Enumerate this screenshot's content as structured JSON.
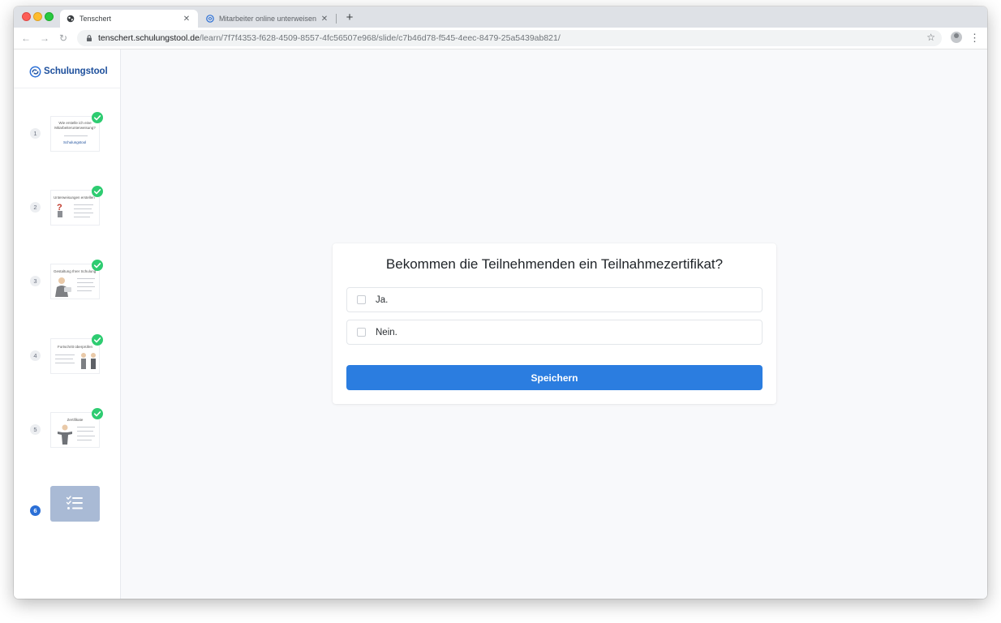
{
  "browser": {
    "tabs": [
      {
        "title": "Tenschert",
        "icon": "globe-icon",
        "close": "✕"
      },
      {
        "title": "Mitarbeiter online unterweisen",
        "icon": "schulungstool-icon",
        "close": "✕"
      }
    ],
    "new_tab": "+",
    "nav": {
      "back": "←",
      "forward": "→",
      "reload": "↻"
    },
    "url": {
      "host": "tenschert.schulungstool.de",
      "path": "/learn/7f7f4353-f628-4509-8557-4fc56507e968/slide/c7b46d78-f545-4eec-8479-25a5439ab821/"
    },
    "bookmark_icon": "☆",
    "menu_icon": "⋮"
  },
  "sidebar": {
    "logo": "Schulungstool",
    "slides": [
      {
        "number": "1",
        "title": "Wie erstelle ich eine Mitarbeiterunterweisung?",
        "brand": "Schulungstool",
        "completed": true
      },
      {
        "number": "2",
        "title": "Unterweisungen erstellen",
        "completed": true
      },
      {
        "number": "3",
        "title": "Gestaltung Ihrer Schulung",
        "completed": true
      },
      {
        "number": "4",
        "title": "Fortschritt überprüfen",
        "completed": true
      },
      {
        "number": "5",
        "title": "Zertifikate",
        "completed": true
      },
      {
        "number": "6",
        "title": "",
        "completed": false,
        "current": true
      }
    ]
  },
  "quiz": {
    "question": "Bekommen die Teilnehmenden ein Teilnahmezertifikat?",
    "answers": [
      {
        "label": "Ja.",
        "checked": false
      },
      {
        "label": "Nein.",
        "checked": false
      }
    ],
    "submit_label": "Speichern"
  },
  "colors": {
    "primary": "#2b7de0",
    "success": "#2ecc71",
    "brand": "#1d4f9c",
    "quiz_thumb": "#a9bad5"
  }
}
